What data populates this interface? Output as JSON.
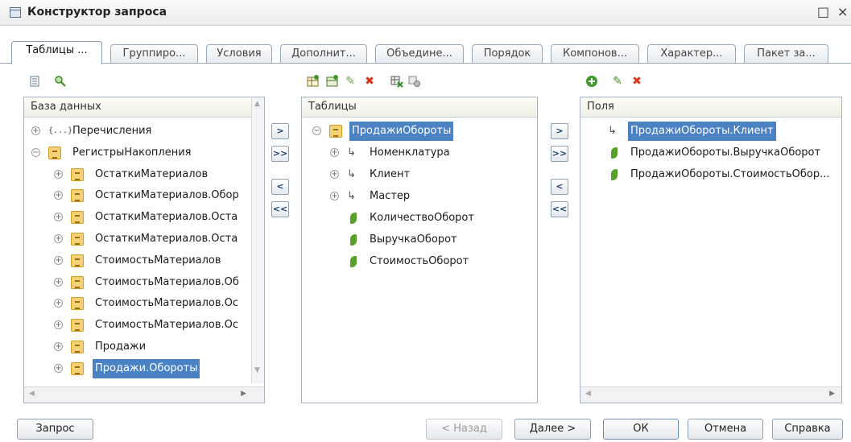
{
  "window": {
    "title": "Конструктор запроса",
    "maximize_glyph": "□",
    "close_glyph": "×"
  },
  "tabs": [
    {
      "label": "Таблицы ...",
      "active": true
    },
    {
      "label": "Группиро...",
      "active": false
    },
    {
      "label": "Условия",
      "active": false
    },
    {
      "label": "Дополнит...",
      "active": false
    },
    {
      "label": "Объедине...",
      "active": false
    },
    {
      "label": "Порядок",
      "active": false
    },
    {
      "label": "Компонов...",
      "active": false
    },
    {
      "label": "Характер...",
      "active": false
    },
    {
      "label": "Пакет за...",
      "active": false
    }
  ],
  "database_panel": {
    "header": "База данных",
    "items": [
      {
        "label": "Перечисления",
        "expander": "+",
        "icon": "enum-icon"
      },
      {
        "label": "РегистрыНакопления",
        "expander": "−",
        "icon": "register-icon"
      },
      {
        "label": "ОстаткиМатериалов",
        "expander": "+",
        "icon": "register-icon"
      },
      {
        "label": "ОстаткиМатериалов.Обор",
        "expander": "+",
        "icon": "register-icon"
      },
      {
        "label": "ОстаткиМатериалов.Оста",
        "expander": "+",
        "icon": "register-icon"
      },
      {
        "label": "ОстаткиМатериалов.Оста",
        "expander": "+",
        "icon": "register-icon"
      },
      {
        "label": "СтоимостьМатериалов",
        "expander": "+",
        "icon": "register-icon"
      },
      {
        "label": "СтоимостьМатериалов.Об",
        "expander": "+",
        "icon": "register-icon"
      },
      {
        "label": "СтоимостьМатериалов.Ос",
        "expander": "+",
        "icon": "register-icon"
      },
      {
        "label": "СтоимостьМатериалов.Ос",
        "expander": "+",
        "icon": "register-icon"
      },
      {
        "label": "Продажи",
        "expander": "+",
        "icon": "register-icon"
      },
      {
        "label": "Продажи.Обороты",
        "expander": "+",
        "icon": "register-icon",
        "selected": true
      }
    ]
  },
  "tables_panel": {
    "header": "Таблицы",
    "items": [
      {
        "label": "ПродажиОбороты",
        "expander": "−",
        "icon": "register-icon",
        "selected": true
      },
      {
        "label": "Номенклатура",
        "expander": "+",
        "icon": "dimension-icon"
      },
      {
        "label": "Клиент",
        "expander": "+",
        "icon": "dimension-icon"
      },
      {
        "label": "Мастер",
        "expander": "+",
        "icon": "dimension-icon"
      },
      {
        "label": "КоличествоОборот",
        "expander": "",
        "icon": "resource-icon"
      },
      {
        "label": "ВыручкаОборот",
        "expander": "",
        "icon": "resource-icon"
      },
      {
        "label": "СтоимостьОборот",
        "expander": "",
        "icon": "resource-icon"
      }
    ]
  },
  "fields_panel": {
    "header": "Поля",
    "items": [
      {
        "label": "ПродажиОбороты.Клиент",
        "icon": "dimension-icon",
        "selected": true
      },
      {
        "label": "ПродажиОбороты.ВыручкаОборот",
        "icon": "resource-icon"
      },
      {
        "label": "ПродажиОбороты.СтоимостьОбор...",
        "icon": "resource-icon"
      }
    ]
  },
  "move_buttons": {
    "add": ">",
    "add_all": ">>",
    "remove": "<",
    "remove_all": "<<"
  },
  "scroll_arrows": {
    "up": "▲",
    "down": "▼",
    "left": "◀",
    "right": "▶"
  },
  "toolbar_glyphs": {
    "delete": "✖",
    "edit": "✎",
    "add": "+"
  },
  "bottom": {
    "query": "Запрос",
    "back": "< Назад",
    "next": "Далее >",
    "ok": "ОК",
    "cancel": "Отмена",
    "help": "Справка"
  }
}
